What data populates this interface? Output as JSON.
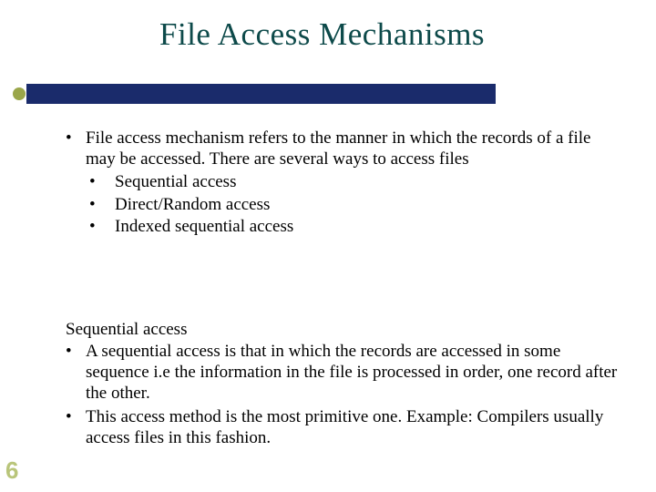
{
  "title": "File Access Mechanisms",
  "intro": "File access mechanism refers to the manner in which the records of a file may be accessed. There are several ways to access files",
  "access_types": [
    "Sequential access",
    "Direct/Random access",
    "Indexed sequential access"
  ],
  "section_heading": "Sequential access",
  "section_points": [
    "A sequential access is that in which the records are accessed in some sequence i.e the information in the file is processed in order, one record after the other.",
    "This access method is the most primitive one. Example: Compilers usually access files in this fashion."
  ],
  "page_number": "6",
  "bullet": "•"
}
